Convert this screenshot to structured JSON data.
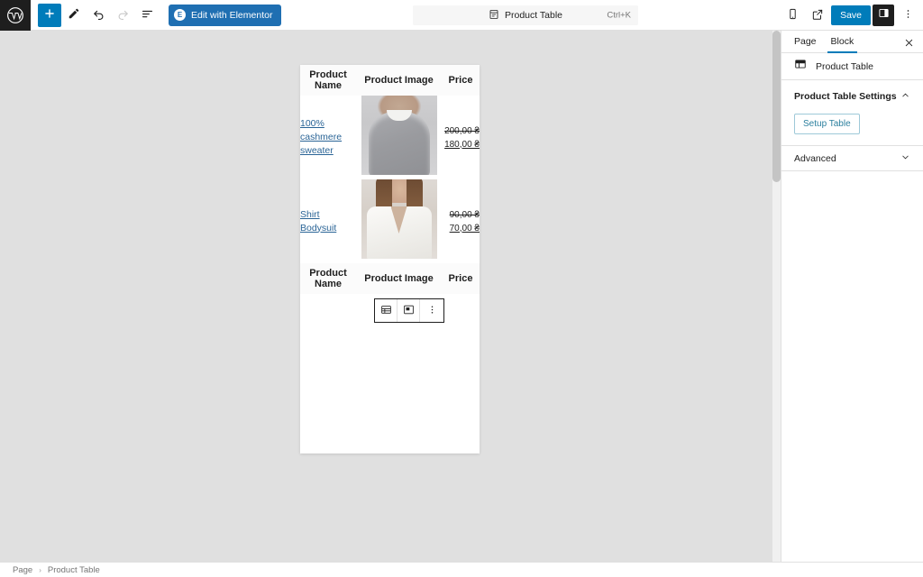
{
  "topbar": {
    "logo_name": "wordpress-logo",
    "add_block_label": "+",
    "tools": [
      {
        "name": "add-block-button",
        "icon": "plus-icon",
        "label": "+"
      },
      {
        "name": "tools-pen-button",
        "icon": "pencil-icon",
        "label": ""
      },
      {
        "name": "undo-button",
        "icon": "undo-arrow-icon",
        "label": ""
      },
      {
        "name": "redo-button",
        "icon": "redo-arrow-icon",
        "label": ""
      },
      {
        "name": "document-overview-button",
        "icon": "list-view-icon",
        "label": ""
      }
    ],
    "elementor_button_label": "Edit with Elementor",
    "elementor_badge": "E",
    "document_title": "Product Table",
    "document_shortcut": "Ctrl+K",
    "view_button": "view-mobile-icon",
    "preview_button": "external-link-icon",
    "save_label": "Save",
    "sidebar_toggle": "settings-panel-icon",
    "options_label": "⋮"
  },
  "canvas": {
    "table": {
      "headers": [
        "Product Name",
        "Product Image",
        "Price"
      ],
      "rows": [
        {
          "name": "100% cashmere sweater",
          "image_alt": "grey cashmere sweater product photo",
          "price_old": "200,00 ₴",
          "price_new": "180,00 ₴"
        },
        {
          "name": "Shirt Bodysuit",
          "image_alt": "white shirt bodysuit product photo",
          "price_old": "90,00 ₴",
          "price_new": "70,00 ₴"
        }
      ],
      "footer_headers": [
        "Product Name",
        "Product Image",
        "Price"
      ]
    },
    "block_toolbar": {
      "buttons": [
        {
          "name": "change-block-type-button",
          "icon": "table-block-icon"
        },
        {
          "name": "align-block-button",
          "icon": "align-image-icon"
        },
        {
          "name": "more-options-button",
          "icon": "vertical-dots-icon"
        }
      ]
    }
  },
  "sidebar": {
    "tabs": [
      {
        "label": "Page",
        "active": false
      },
      {
        "label": "Block",
        "active": true
      }
    ],
    "close_label": "✕",
    "block_name": "Product Table",
    "block_icon": "table-block-icon",
    "sections": [
      {
        "title": "Product Table Settings",
        "expanded": true,
        "button_label": "Setup Table",
        "chevron": "chevron-up-icon"
      },
      {
        "title": "Advanced",
        "expanded": false,
        "chevron": "chevron-down-icon"
      }
    ]
  },
  "bottombar": {
    "crumbs": [
      "Page",
      "Product Table"
    ],
    "separator": "›"
  },
  "colors": {
    "accent": "#007cba",
    "elementor": "#1f6fb2",
    "link": "#2a6496",
    "setup_button_text": "#2b7f9e",
    "canvas_bg": "#e0e0e0"
  }
}
